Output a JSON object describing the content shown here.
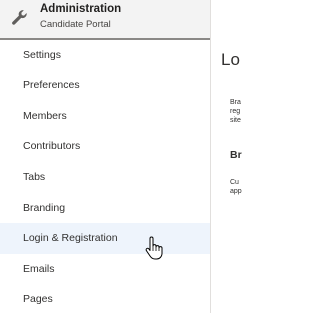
{
  "header": {
    "title": "Administration",
    "subtitle": "Candidate Portal",
    "icon": "wrench-icon"
  },
  "sidebar": {
    "items": [
      {
        "label": "Settings"
      },
      {
        "label": "Preferences"
      },
      {
        "label": "Members"
      },
      {
        "label": "Contributors"
      },
      {
        "label": "Tabs"
      },
      {
        "label": "Branding"
      },
      {
        "label": "Login & Registration",
        "hovered": true
      },
      {
        "label": "Emails"
      },
      {
        "label": "Pages"
      }
    ]
  },
  "content": {
    "page_title": "Lo",
    "description_fragments": [
      "Bra",
      "reg",
      "site"
    ],
    "section_title": "Br",
    "section_description_fragments": [
      "Cu",
      "app"
    ]
  },
  "colors": {
    "header_bg": "#f3f3f3",
    "header_line": "#8a8886",
    "hover_bg": "#eef4fc",
    "text": "#323130"
  }
}
